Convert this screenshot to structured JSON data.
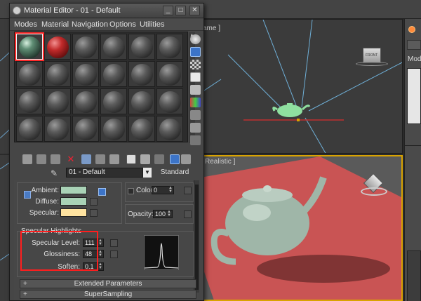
{
  "window": {
    "title": "Material Editor - 01 - Default",
    "minimize": "_",
    "maximize": "□",
    "close": "✕"
  },
  "menu": [
    "Modes",
    "Material",
    "Navigation",
    "Options",
    "Utilities"
  ],
  "material": {
    "name": "01 - Default",
    "type": "Standard"
  },
  "basic_params": {
    "ambient_label": "Ambient:",
    "diffuse_label": "Diffuse:",
    "specular_label": "Specular:",
    "ambient_color": "#a9d2b6",
    "diffuse_color": "#a9d2b6",
    "specular_color": "#ffe3a0",
    "self_illum_label": "Color",
    "self_illum_value": "0",
    "opacity_label": "Opacity:",
    "opacity_value": "100"
  },
  "specular_highlights": {
    "title": "Specular Highlights",
    "level_label": "Specular Level:",
    "level_value": "111",
    "gloss_label": "Glossiness:",
    "gloss_value": "48",
    "soften_label": "Soften:",
    "soften_value": "0.1"
  },
  "rollouts": {
    "extended": "Extended Parameters",
    "supersampling": "SuperSampling"
  },
  "viewports": {
    "top_label": "ame ]",
    "persp_label": "Realistic ]",
    "front_cube": "FRONT"
  },
  "command_panel": {
    "modifier_label": "Modi"
  },
  "colors": {
    "accent": "#d9a300",
    "selection": "#ff1e1e",
    "teapot_top": "#9fe0a8",
    "ground": "#c95454"
  }
}
